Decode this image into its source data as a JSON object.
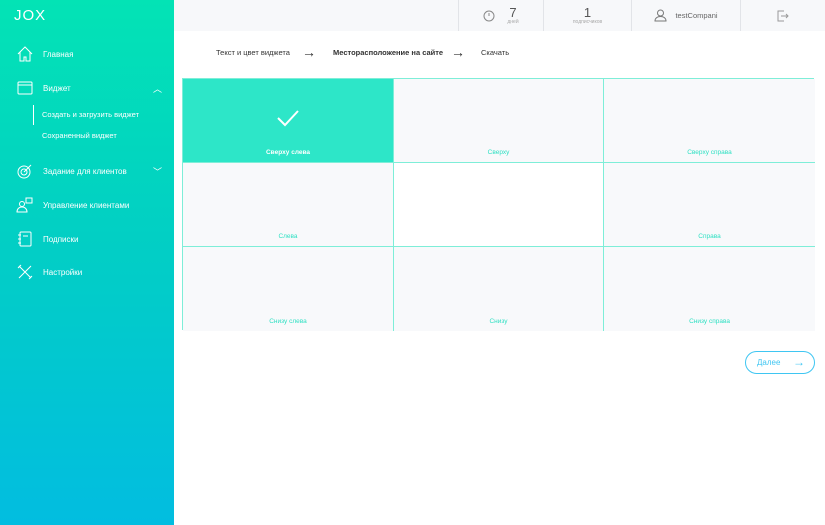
{
  "logo": "JOX",
  "sidebar": {
    "items": [
      {
        "label": "Главная",
        "icon": "home-icon"
      },
      {
        "label": "Виджет",
        "icon": "browser-window-icon"
      },
      {
        "label": "Задание для клиентов",
        "icon": "target-icon"
      },
      {
        "label": "Управление клиентами",
        "icon": "users-manage-icon"
      },
      {
        "label": "Подписки",
        "icon": "notebook-icon"
      },
      {
        "label": "Настройки",
        "icon": "tools-icon"
      }
    ],
    "sub_items": [
      "Создать и загрузить виджет",
      "Сохраненный виджет"
    ]
  },
  "header": {
    "days_value": "7",
    "days_label": "дней",
    "subs_value": "1",
    "subs_label": "подписчиков",
    "username": "testCompani"
  },
  "steps": [
    "Текст и цвет виджета",
    "Месторасположение на сайте",
    "Скачать"
  ],
  "positions": [
    "Сверху слева",
    "Сверху",
    "Сверху справа",
    "Слева",
    "",
    "Справа",
    "Снизу слева",
    "Снизу",
    "Снизу справа"
  ],
  "selected": "Сверху слева",
  "next_label": "Далее"
}
